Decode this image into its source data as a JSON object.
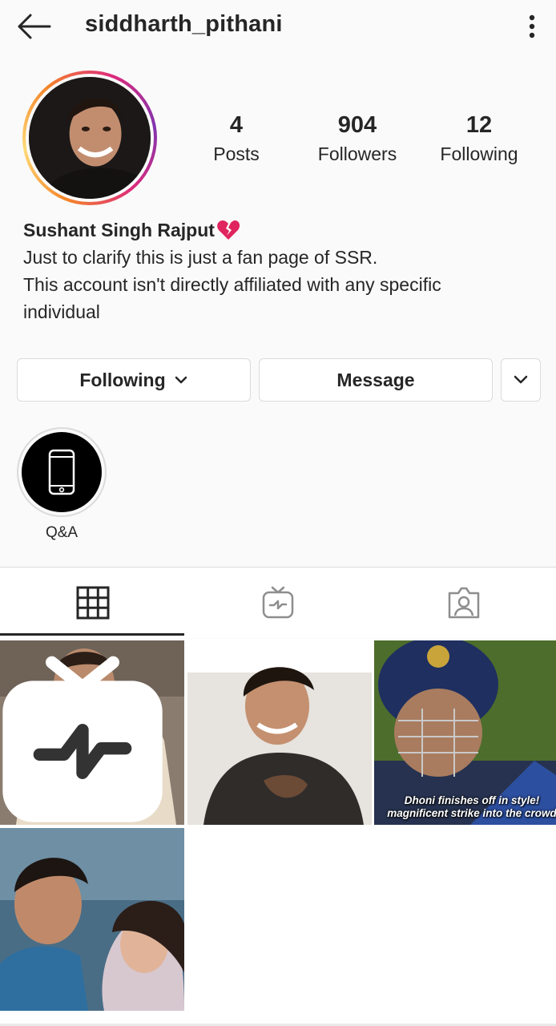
{
  "header": {
    "username": "siddharth_pithani",
    "back_icon": "arrow-left-icon",
    "more_icon": "vertical-dots-icon"
  },
  "stats": {
    "posts": {
      "value": "4",
      "label": "Posts"
    },
    "followers": {
      "value": "904",
      "label": "Followers"
    },
    "following": {
      "value": "12",
      "label": "Following"
    }
  },
  "bio": {
    "name": "Sushant Singh Rajput",
    "name_emoji": "broken-heart-icon",
    "lines": [
      "Just to clarify this is just a fan page of SSR.",
      "This account isn't directly affiliated with any specific",
      "individual"
    ]
  },
  "actions": {
    "following_label": "Following",
    "message_label": "Message"
  },
  "highlights": [
    {
      "label": "Q&A",
      "icon": "phone-icon"
    }
  ],
  "tabs": [
    {
      "name": "grid",
      "icon": "grid-icon",
      "active": true
    },
    {
      "name": "igtv",
      "icon": "igtv-icon",
      "active": false
    },
    {
      "name": "tagged",
      "icon": "tagged-person-icon",
      "active": false
    }
  ],
  "posts": [
    {
      "caption": "",
      "badge": "igtv-icon"
    },
    {
      "caption": ""
    },
    {
      "caption_lines": [
        "Dhoni finishes off in style!",
        "magnificent strike into the crowd"
      ]
    },
    {
      "caption": ""
    }
  ],
  "colors": {
    "text": "#262626",
    "border": "#dbdbdb",
    "background": "#fafafa",
    "ring_start": "#f58529",
    "ring_end": "#8134af",
    "heart": "#e0245e"
  }
}
